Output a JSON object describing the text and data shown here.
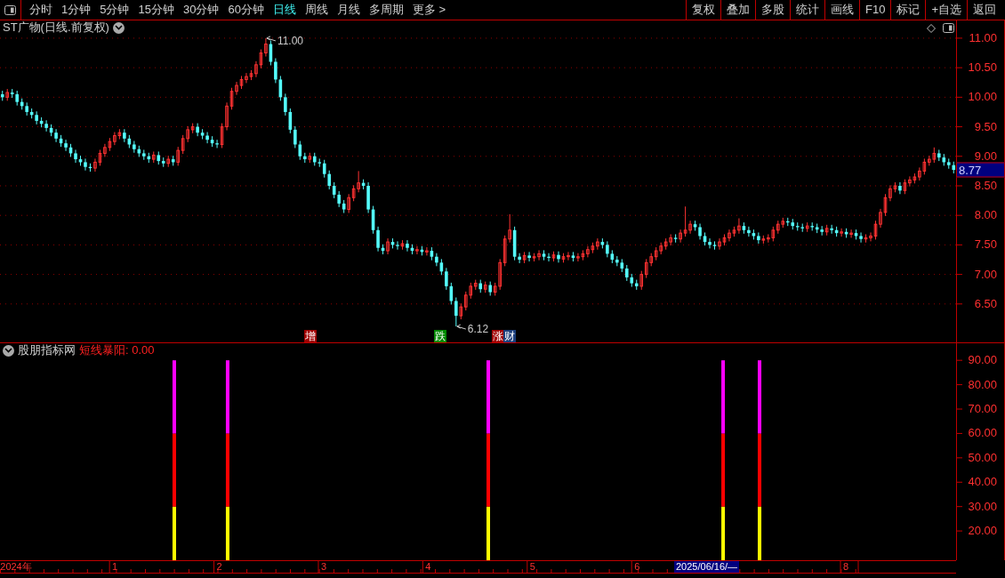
{
  "toolbar": {
    "tabs": [
      {
        "label": "分时",
        "selected": false
      },
      {
        "label": "1分钟",
        "selected": false
      },
      {
        "label": "5分钟",
        "selected": false
      },
      {
        "label": "15分钟",
        "selected": false
      },
      {
        "label": "30分钟",
        "selected": false
      },
      {
        "label": "60分钟",
        "selected": false
      },
      {
        "label": "日线",
        "selected": true
      },
      {
        "label": "周线",
        "selected": false
      },
      {
        "label": "月线",
        "selected": false
      },
      {
        "label": "多周期",
        "selected": false
      },
      {
        "label": "更多 >",
        "selected": false
      }
    ],
    "buttons": [
      "复权",
      "叠加",
      "多股",
      "统计",
      "画线",
      "F10",
      "标记",
      "+自选",
      "返回"
    ]
  },
  "price_panel": {
    "title": "ST广物(日线.前复权)",
    "current_price": "8.77",
    "high_label": "11.00",
    "low_label": "6.12",
    "signals": [
      {
        "text": "增",
        "color": "#a00000"
      },
      {
        "text": "跌",
        "color": "#008a00"
      },
      {
        "text": "涨",
        "color": "#a00000"
      },
      {
        "text": "财",
        "color": "#1c3f7c"
      }
    ],
    "chart_data": {
      "type": "candlestick",
      "grid": true,
      "ylim": [
        5.85,
        11.3
      ],
      "yticks": [
        {
          "value": 11,
          "label": "11.00"
        },
        {
          "value": 10.5,
          "label": "10.50"
        },
        {
          "value": 10,
          "label": "10.00"
        },
        {
          "value": 9.5,
          "label": "9.50"
        },
        {
          "value": 9,
          "label": "9.00"
        },
        {
          "value": 8.5,
          "label": "8.50"
        },
        {
          "value": 8,
          "label": "8.00"
        },
        {
          "value": 7.5,
          "label": "7.50"
        },
        {
          "value": 7,
          "label": "7.00"
        },
        {
          "value": 6.5,
          "label": "6.50"
        }
      ],
      "categories": [
        null,
        null,
        null,
        null,
        null,
        null,
        null,
        null,
        null,
        null,
        null,
        null,
        null,
        null,
        null,
        null,
        null,
        null,
        null,
        null,
        null,
        null,
        null,
        null,
        null,
        null,
        null,
        null,
        null,
        null,
        null,
        null,
        null,
        null,
        null,
        null,
        null,
        null,
        null,
        null,
        null,
        null,
        null,
        null,
        null,
        null,
        null,
        null,
        null,
        null,
        null,
        null,
        null,
        null,
        null,
        null,
        null,
        null,
        null,
        null,
        null,
        null,
        null,
        null,
        null,
        null,
        null,
        null,
        null,
        null,
        null,
        null,
        null,
        null,
        null,
        null,
        null,
        null,
        null,
        null,
        null,
        null,
        null,
        null,
        null,
        null,
        null,
        null,
        null,
        null,
        null,
        null,
        null,
        null,
        null,
        null,
        null,
        null,
        null,
        null,
        null,
        null,
        null,
        null,
        null,
        null,
        null,
        null,
        null,
        null,
        null,
        null,
        null,
        null,
        null,
        null,
        null,
        null,
        null,
        null,
        null,
        null,
        null,
        null,
        null,
        null,
        null,
        null,
        null,
        null,
        null,
        null,
        null,
        null,
        null,
        null,
        null,
        null,
        null,
        null,
        null,
        null,
        null,
        null,
        null,
        null,
        null,
        null,
        null,
        null,
        null,
        null,
        null,
        null,
        null,
        null,
        null,
        null,
        null,
        null,
        null,
        null,
        null,
        null,
        null,
        null,
        null,
        null,
        null,
        null,
        null,
        null,
        null,
        null,
        null,
        null,
        null,
        null,
        null,
        null,
        null,
        null,
        null,
        null,
        null,
        null,
        null,
        null,
        null,
        null,
        null,
        null,
        null,
        null,
        null,
        null
      ],
      "ohlc": [
        [
          10.05,
          10.11,
          9.94,
          10.0
        ],
        [
          10.0,
          10.14,
          9.94,
          10.08
        ],
        [
          10.08,
          10.14,
          9.99,
          10.05
        ],
        [
          10.05,
          10.11,
          9.86,
          9.92
        ],
        [
          9.92,
          9.98,
          9.79,
          9.85
        ],
        [
          9.85,
          9.91,
          9.69,
          9.75
        ],
        [
          9.75,
          9.81,
          9.64,
          9.7
        ],
        [
          9.7,
          9.76,
          9.54,
          9.6
        ],
        [
          9.6,
          9.66,
          9.49,
          9.55
        ],
        [
          9.55,
          9.61,
          9.42,
          9.48
        ],
        [
          9.48,
          9.54,
          9.34,
          9.4
        ],
        [
          9.4,
          9.46,
          9.24,
          9.3
        ],
        [
          9.3,
          9.36,
          9.16,
          9.22
        ],
        [
          9.22,
          9.28,
          9.09,
          9.15
        ],
        [
          9.15,
          9.21,
          8.99,
          9.05
        ],
        [
          9.05,
          9.11,
          8.89,
          8.95
        ],
        [
          8.95,
          9.01,
          8.84,
          8.9
        ],
        [
          8.9,
          8.96,
          8.76,
          8.82
        ],
        [
          8.82,
          8.88,
          8.74,
          8.8
        ],
        [
          8.8,
          8.96,
          8.74,
          8.9
        ],
        [
          8.9,
          9.11,
          8.84,
          9.05
        ],
        [
          9.05,
          9.21,
          8.99,
          9.15
        ],
        [
          9.15,
          9.31,
          9.09,
          9.25
        ],
        [
          9.25,
          9.41,
          9.19,
          9.35
        ],
        [
          9.35,
          9.46,
          9.29,
          9.4
        ],
        [
          9.4,
          9.46,
          9.24,
          9.3
        ],
        [
          9.3,
          9.36,
          9.14,
          9.2
        ],
        [
          9.2,
          9.26,
          9.06,
          9.12
        ],
        [
          9.12,
          9.18,
          8.99,
          9.05
        ],
        [
          9.05,
          9.11,
          8.94,
          9.0
        ],
        [
          9.0,
          9.06,
          8.89,
          8.95
        ],
        [
          8.95,
          9.08,
          8.89,
          9.02
        ],
        [
          9.02,
          9.08,
          8.86,
          8.92
        ],
        [
          8.92,
          8.98,
          8.82,
          8.88
        ],
        [
          8.88,
          9.01,
          8.82,
          8.95
        ],
        [
          8.95,
          9.01,
          8.84,
          8.9
        ],
        [
          8.9,
          9.16,
          8.84,
          9.1
        ],
        [
          9.1,
          9.36,
          9.04,
          9.3
        ],
        [
          9.3,
          9.51,
          9.24,
          9.45
        ],
        [
          9.45,
          9.56,
          9.39,
          9.5
        ],
        [
          9.5,
          9.56,
          9.34,
          9.4
        ],
        [
          9.4,
          9.46,
          9.29,
          9.35
        ],
        [
          9.35,
          9.41,
          9.22,
          9.28
        ],
        [
          9.28,
          9.34,
          9.16,
          9.22
        ],
        [
          9.22,
          9.28,
          9.14,
          9.2
        ],
        [
          9.2,
          9.56,
          9.14,
          9.5
        ],
        [
          9.5,
          9.91,
          9.44,
          9.85
        ],
        [
          9.85,
          10.16,
          9.79,
          10.1
        ],
        [
          10.1,
          10.26,
          10.04,
          10.2
        ],
        [
          10.2,
          10.36,
          10.14,
          10.3
        ],
        [
          10.3,
          10.41,
          10.24,
          10.35
        ],
        [
          10.35,
          10.46,
          10.29,
          10.4
        ],
        [
          10.4,
          10.61,
          10.34,
          10.55
        ],
        [
          10.55,
          10.81,
          10.49,
          10.75
        ],
        [
          10.75,
          11.0,
          10.69,
          10.9
        ],
        [
          10.9,
          10.96,
          10.54,
          10.6
        ],
        [
          10.6,
          10.66,
          10.24,
          10.3
        ],
        [
          10.3,
          10.36,
          9.94,
          10.0
        ],
        [
          10.0,
          10.06,
          9.69,
          9.75
        ],
        [
          9.75,
          9.81,
          9.39,
          9.45
        ],
        [
          9.45,
          9.51,
          9.14,
          9.2
        ],
        [
          9.2,
          9.26,
          8.94,
          9.0
        ],
        [
          9.0,
          9.06,
          8.89,
          8.95
        ],
        [
          8.95,
          9.06,
          8.89,
          9.0
        ],
        [
          9.0,
          9.06,
          8.84,
          8.9
        ],
        [
          8.9,
          8.96,
          8.82,
          8.88
        ],
        [
          8.88,
          8.94,
          8.64,
          8.7
        ],
        [
          8.7,
          8.76,
          8.44,
          8.5
        ],
        [
          8.5,
          8.56,
          8.29,
          8.35
        ],
        [
          8.35,
          8.41,
          8.14,
          8.2
        ],
        [
          8.2,
          8.26,
          8.04,
          8.1
        ],
        [
          8.1,
          8.36,
          8.04,
          8.3
        ],
        [
          8.3,
          8.51,
          8.24,
          8.45
        ],
        [
          8.45,
          8.75,
          8.39,
          8.55
        ],
        [
          8.55,
          8.61,
          8.44,
          8.5
        ],
        [
          8.5,
          8.56,
          8.04,
          8.1
        ],
        [
          8.1,
          8.16,
          7.69,
          7.75
        ],
        [
          7.75,
          7.81,
          7.39,
          7.45
        ],
        [
          7.45,
          7.51,
          7.34,
          7.4
        ],
        [
          7.4,
          7.61,
          7.34,
          7.55
        ],
        [
          7.55,
          7.61,
          7.44,
          7.5
        ],
        [
          7.5,
          7.56,
          7.42,
          7.48
        ],
        [
          7.48,
          7.58,
          7.42,
          7.52
        ],
        [
          7.52,
          7.58,
          7.39,
          7.45
        ],
        [
          7.45,
          7.51,
          7.34,
          7.4
        ],
        [
          7.4,
          7.48,
          7.34,
          7.42
        ],
        [
          7.42,
          7.48,
          7.32,
          7.38
        ],
        [
          7.38,
          7.46,
          7.32,
          7.4
        ],
        [
          7.4,
          7.46,
          7.24,
          7.3
        ],
        [
          7.3,
          7.36,
          7.14,
          7.2
        ],
        [
          7.2,
          7.26,
          6.99,
          7.05
        ],
        [
          7.05,
          7.11,
          6.74,
          6.8
        ],
        [
          6.8,
          6.86,
          6.49,
          6.55
        ],
        [
          6.55,
          6.61,
          6.12,
          6.3
        ],
        [
          6.3,
          6.51,
          6.24,
          6.45
        ],
        [
          6.45,
          6.71,
          6.39,
          6.65
        ],
        [
          6.65,
          6.86,
          6.59,
          6.8
        ],
        [
          6.8,
          6.91,
          6.74,
          6.85
        ],
        [
          6.85,
          6.91,
          6.69,
          6.75
        ],
        [
          6.75,
          6.88,
          6.69,
          6.82
        ],
        [
          6.82,
          6.88,
          6.64,
          6.7
        ],
        [
          6.7,
          6.86,
          6.64,
          6.8
        ],
        [
          6.8,
          7.26,
          6.74,
          7.2
        ],
        [
          7.2,
          7.66,
          7.14,
          7.6
        ],
        [
          7.6,
          8.02,
          7.54,
          7.75
        ],
        [
          7.75,
          7.81,
          7.24,
          7.3
        ],
        [
          7.3,
          7.36,
          7.19,
          7.25
        ],
        [
          7.25,
          7.38,
          7.19,
          7.32
        ],
        [
          7.32,
          7.38,
          7.22,
          7.28
        ],
        [
          7.28,
          7.36,
          7.22,
          7.3
        ],
        [
          7.3,
          7.41,
          7.24,
          7.35
        ],
        [
          7.35,
          7.41,
          7.24,
          7.3
        ],
        [
          7.3,
          7.36,
          7.22,
          7.28
        ],
        [
          7.28,
          7.39,
          7.22,
          7.33
        ],
        [
          7.33,
          7.39,
          7.2,
          7.26
        ],
        [
          7.26,
          7.36,
          7.2,
          7.3
        ],
        [
          7.3,
          7.38,
          7.24,
          7.32
        ],
        [
          7.32,
          7.38,
          7.22,
          7.28
        ],
        [
          7.28,
          7.36,
          7.22,
          7.3
        ],
        [
          7.3,
          7.41,
          7.24,
          7.35
        ],
        [
          7.35,
          7.48,
          7.29,
          7.42
        ],
        [
          7.42,
          7.54,
          7.36,
          7.48
        ],
        [
          7.48,
          7.61,
          7.42,
          7.55
        ],
        [
          7.55,
          7.61,
          7.44,
          7.5
        ],
        [
          7.5,
          7.56,
          7.29,
          7.35
        ],
        [
          7.35,
          7.41,
          7.19,
          7.25
        ],
        [
          7.25,
          7.31,
          7.14,
          7.2
        ],
        [
          7.2,
          7.26,
          7.04,
          7.1
        ],
        [
          7.1,
          7.16,
          6.89,
          6.95
        ],
        [
          6.95,
          7.01,
          6.79,
          6.85
        ],
        [
          6.85,
          6.91,
          6.74,
          6.8
        ],
        [
          6.8,
          7.06,
          6.74,
          7.0
        ],
        [
          7.0,
          7.26,
          6.94,
          7.2
        ],
        [
          7.2,
          7.36,
          7.14,
          7.3
        ],
        [
          7.3,
          7.46,
          7.24,
          7.4
        ],
        [
          7.4,
          7.54,
          7.34,
          7.48
        ],
        [
          7.48,
          7.61,
          7.42,
          7.55
        ],
        [
          7.55,
          7.68,
          7.49,
          7.62
        ],
        [
          7.62,
          7.68,
          7.54,
          7.6
        ],
        [
          7.6,
          7.76,
          7.54,
          7.7
        ],
        [
          7.7,
          8.15,
          7.64,
          7.75
        ],
        [
          7.75,
          7.91,
          7.69,
          7.85
        ],
        [
          7.85,
          7.91,
          7.74,
          7.8
        ],
        [
          7.8,
          7.86,
          7.59,
          7.65
        ],
        [
          7.65,
          7.71,
          7.49,
          7.55
        ],
        [
          7.55,
          7.61,
          7.44,
          7.5
        ],
        [
          7.5,
          7.56,
          7.42,
          7.48
        ],
        [
          7.48,
          7.61,
          7.42,
          7.55
        ],
        [
          7.55,
          7.68,
          7.49,
          7.62
        ],
        [
          7.62,
          7.76,
          7.56,
          7.7
        ],
        [
          7.7,
          7.81,
          7.64,
          7.75
        ],
        [
          7.75,
          7.95,
          7.69,
          7.82
        ],
        [
          7.82,
          7.88,
          7.69,
          7.75
        ],
        [
          7.75,
          7.81,
          7.64,
          7.7
        ],
        [
          7.7,
          7.76,
          7.59,
          7.65
        ],
        [
          7.65,
          7.71,
          7.52,
          7.58
        ],
        [
          7.58,
          7.66,
          7.52,
          7.6
        ],
        [
          7.6,
          7.68,
          7.54,
          7.62
        ],
        [
          7.62,
          7.81,
          7.56,
          7.75
        ],
        [
          7.75,
          7.91,
          7.69,
          7.85
        ],
        [
          7.85,
          7.96,
          7.79,
          7.9
        ],
        [
          7.9,
          7.96,
          7.82,
          7.88
        ],
        [
          7.88,
          7.94,
          7.76,
          7.82
        ],
        [
          7.82,
          7.88,
          7.74,
          7.8
        ],
        [
          7.8,
          7.86,
          7.72,
          7.78
        ],
        [
          7.78,
          7.88,
          7.72,
          7.82
        ],
        [
          7.82,
          7.88,
          7.74,
          7.8
        ],
        [
          7.8,
          7.86,
          7.7,
          7.76
        ],
        [
          7.76,
          7.82,
          7.66,
          7.72
        ],
        [
          7.72,
          7.84,
          7.66,
          7.78
        ],
        [
          7.78,
          7.84,
          7.69,
          7.75
        ],
        [
          7.75,
          7.81,
          7.64,
          7.7
        ],
        [
          7.7,
          7.78,
          7.64,
          7.72
        ],
        [
          7.72,
          7.78,
          7.62,
          7.68
        ],
        [
          7.68,
          7.76,
          7.62,
          7.7
        ],
        [
          7.7,
          7.76,
          7.59,
          7.65
        ],
        [
          7.65,
          7.71,
          7.54,
          7.6
        ],
        [
          7.6,
          7.68,
          7.54,
          7.62
        ],
        [
          7.62,
          7.71,
          7.56,
          7.65
        ],
        [
          7.65,
          7.91,
          7.59,
          7.85
        ],
        [
          7.85,
          8.11,
          7.79,
          8.05
        ],
        [
          8.05,
          8.36,
          7.99,
          8.3
        ],
        [
          8.3,
          8.51,
          8.24,
          8.45
        ],
        [
          8.45,
          8.56,
          8.39,
          8.5
        ],
        [
          8.5,
          8.56,
          8.36,
          8.42
        ],
        [
          8.42,
          8.61,
          8.36,
          8.55
        ],
        [
          8.55,
          8.66,
          8.49,
          8.6
        ],
        [
          8.6,
          8.71,
          8.54,
          8.65
        ],
        [
          8.65,
          8.81,
          8.59,
          8.75
        ],
        [
          8.75,
          8.96,
          8.69,
          8.9
        ],
        [
          8.9,
          9.01,
          8.84,
          8.95
        ],
        [
          8.95,
          9.15,
          8.89,
          9.05
        ],
        [
          9.05,
          9.11,
          8.92,
          8.98
        ],
        [
          8.98,
          9.04,
          8.84,
          8.9
        ],
        [
          8.9,
          8.96,
          8.79,
          8.85
        ],
        [
          8.85,
          8.91,
          8.71,
          8.77
        ]
      ]
    }
  },
  "indicator_panel": {
    "source": "股朋指标网",
    "indicator": "短线暴阳: 0.00",
    "chart_data": {
      "type": "bar",
      "stacked": true,
      "x": [
        1.569,
        2.08,
        4.576,
        6.825,
        7.174
      ],
      "xlim": [
        -0.1,
        9.056
      ],
      "ylim": [
        8,
        97
      ],
      "xticks": [
        1,
        2,
        3,
        4,
        5,
        6,
        8
      ],
      "series": [
        {
          "color": "#ffff00",
          "values": [
            30,
            30,
            30,
            30,
            30
          ]
        },
        {
          "color": "#ff0000",
          "values": [
            30,
            30,
            30,
            30,
            30
          ]
        },
        {
          "color": "#ff00ff",
          "values": [
            30,
            30,
            30,
            30,
            30
          ]
        }
      ],
      "yticks": [
        {
          "value": 90,
          "label": "90.00"
        },
        {
          "value": 80,
          "label": "80.00"
        },
        {
          "value": 70,
          "label": "70.00"
        },
        {
          "value": 60,
          "label": "60.00"
        },
        {
          "value": 50,
          "label": "50.00"
        },
        {
          "value": 40,
          "label": "40.00"
        },
        {
          "value": 30,
          "label": "30.00"
        },
        {
          "value": 20,
          "label": "20.00"
        }
      ]
    }
  },
  "date_axis": {
    "year_label": "2024年",
    "cursor_date": "2025/06/16/—"
  }
}
